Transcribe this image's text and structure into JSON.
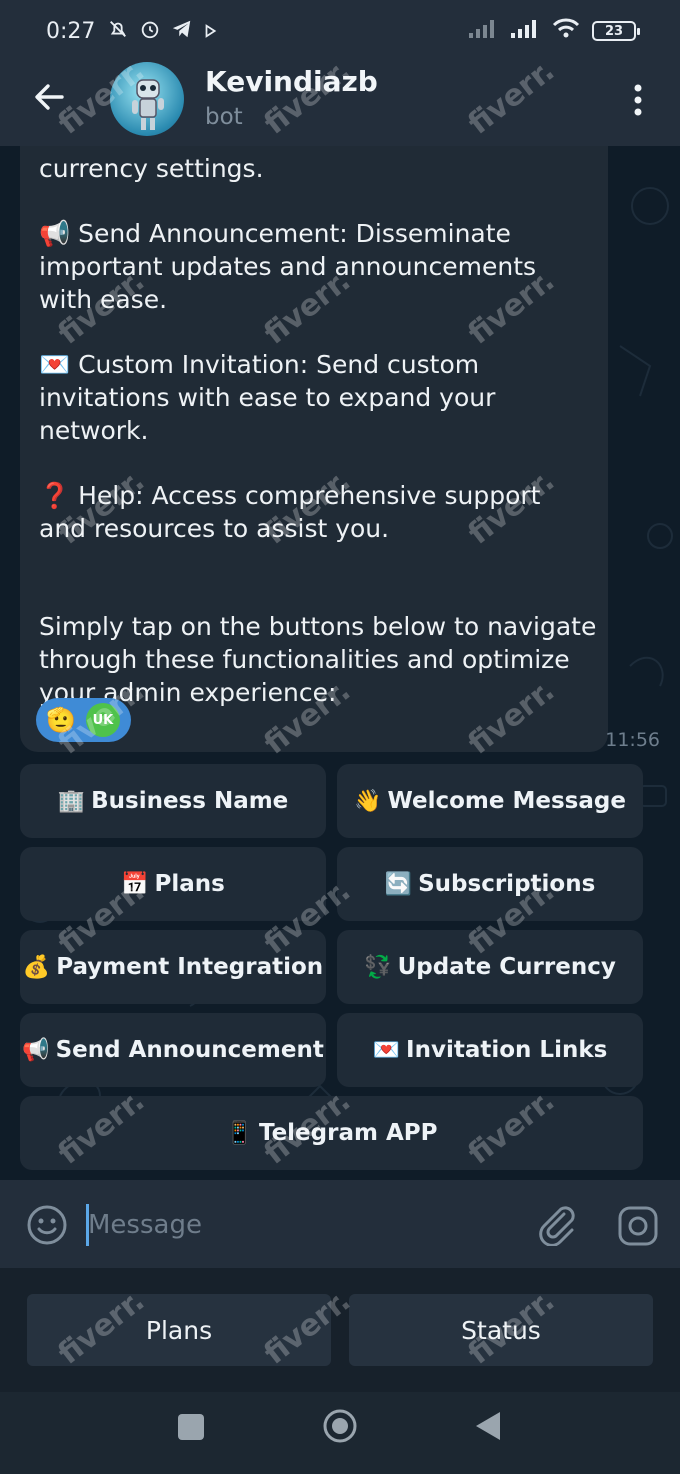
{
  "status_bar": {
    "time": "0:27",
    "battery": "23",
    "icons": [
      "mute-bell-icon",
      "alarm-icon",
      "telegram-icon",
      "play-icon",
      "signal-icon",
      "signal-icon",
      "wifi-icon",
      "battery-icon"
    ]
  },
  "header": {
    "title": "Kevindiazb",
    "subtitle": "bot"
  },
  "message": {
    "lines_top": [
      "currency settings."
    ],
    "para1": [
      "📢 Send Announcement: Disseminate",
      "important updates and announcements",
      "with ease."
    ],
    "para2": [
      "💌 Custom Invitation: Send custom",
      "invitations with ease to expand your",
      "network."
    ],
    "para3": [
      "❓ Help: Access comprehensive support",
      "and resources to assist you."
    ],
    "para4": [
      "Simply tap on the buttons below to navigate",
      "through these functionalities and optimize",
      "your admin experience:"
    ],
    "reaction_emoji": "🫡",
    "reaction_badge": "UK",
    "time": "11:56"
  },
  "inline_keyboard": [
    {
      "emoji": "🏢",
      "label": "Business Name"
    },
    {
      "emoji": "👋",
      "label": "Welcome Message"
    },
    {
      "emoji": "📅",
      "label": "Plans"
    },
    {
      "emoji": "🔄",
      "label": "Subscriptions"
    },
    {
      "emoji": "💰",
      "label": "Payment Integration"
    },
    {
      "emoji": "💱",
      "label": "Update Currency"
    },
    {
      "emoji": "📢",
      "label": "Send Announcement"
    },
    {
      "emoji": "💌",
      "label": "Invitation Links"
    },
    {
      "emoji": "📱",
      "label": "Telegram APP"
    }
  ],
  "composer": {
    "placeholder": "Message"
  },
  "reply_keyboard": [
    "Plans",
    "Status"
  ],
  "watermark": "fiverr.",
  "colors": {
    "header_bg": "#232e3b",
    "chat_bg": "#0f1c28",
    "bubble_bg": "#202b36",
    "button_bg": "#1f2b37",
    "accent": "#5ca8e8"
  }
}
